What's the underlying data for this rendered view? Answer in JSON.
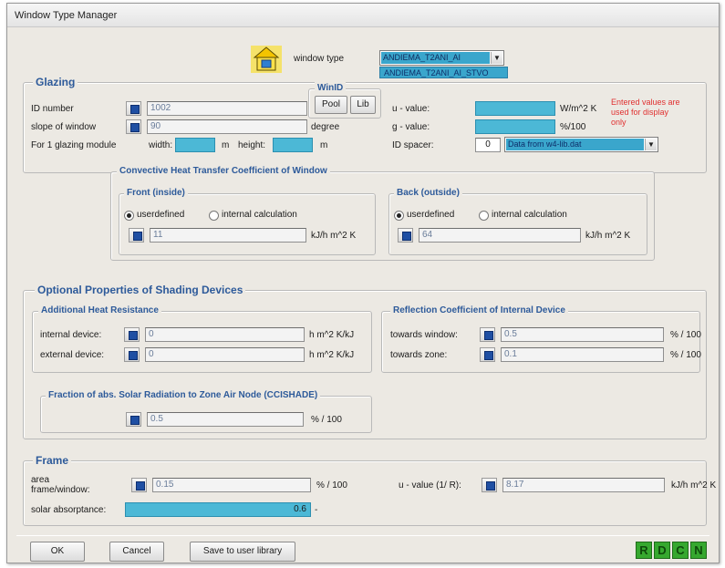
{
  "window": {
    "title": "Window Type Manager"
  },
  "header": {
    "window_type_label": "window type",
    "window_type_value": "ANDIEMA_T2ANI_AI",
    "window_type_dropdown_item": "ANDIEMA_T2ANI_AI_STVO",
    "house_icon": "house-icon"
  },
  "glazing": {
    "title": "Glazing",
    "id_number_label": "ID number",
    "id_number_value": "1002",
    "slope_label": "slope of window",
    "slope_value": "90",
    "slope_unit": "degree",
    "module_label": "For 1 glazing module",
    "width_label": "width:",
    "width_unit": "m",
    "height_label": "height:",
    "height_unit": "m",
    "winid_title": "WinID",
    "pool_button": "Pool",
    "lib_button": "Lib",
    "u_value_label": "u - value:",
    "u_value_unit": "W/m^2 K",
    "g_value_label": "g - value:",
    "g_value_unit": "%/100",
    "id_spacer_label": "ID spacer:",
    "id_spacer_value": "0",
    "spacer_source": "Data from w4-lib.dat",
    "note": "Entered values are used for display only"
  },
  "convective": {
    "title": "Convective Heat Transfer Coefficient of Window",
    "front_title": "Front (inside)",
    "back_title": "Back (outside)",
    "option_undefined": "userdefined",
    "option_internal": "internal calculation",
    "front_value": "11",
    "back_value": "64",
    "unit": "kJ/h m^2 K"
  },
  "shading": {
    "title": "Optional Properties of Shading Devices",
    "resistance_title": "Additional Heat Resistance",
    "internal_label": "internal device:",
    "internal_value": "0",
    "external_label": "external device:",
    "external_value": "0",
    "resistance_unit": "h m^2 K/kJ",
    "reflection_title": "Reflection Coefficient of Internal Device",
    "towards_window_label": "towards window:",
    "towards_window_value": "0.5",
    "towards_zone_label": "towards zone:",
    "towards_zone_value": "0.1",
    "reflection_unit": "% / 100",
    "fraction_title": "Fraction of abs. Solar Radiation to Zone Air Node (CCISHADE)",
    "fraction_value": "0.5",
    "fraction_unit": "% / 100"
  },
  "frame": {
    "title": "Frame",
    "area_label_1": "area",
    "area_label_2": "frame/window:",
    "area_value": "0.15",
    "area_unit": "% / 100",
    "u_value_label": "u - value (1/ R):",
    "u_value": "8.17",
    "u_value_unit": "kJ/h m^2 K",
    "solar_label": "solar absorptance:",
    "solar_value": "0.6",
    "solar_suffix": "-"
  },
  "footer": {
    "ok": "OK",
    "cancel": "Cancel",
    "save": "Save to user library",
    "r": "R",
    "d": "D",
    "c": "C",
    "n": "N"
  }
}
